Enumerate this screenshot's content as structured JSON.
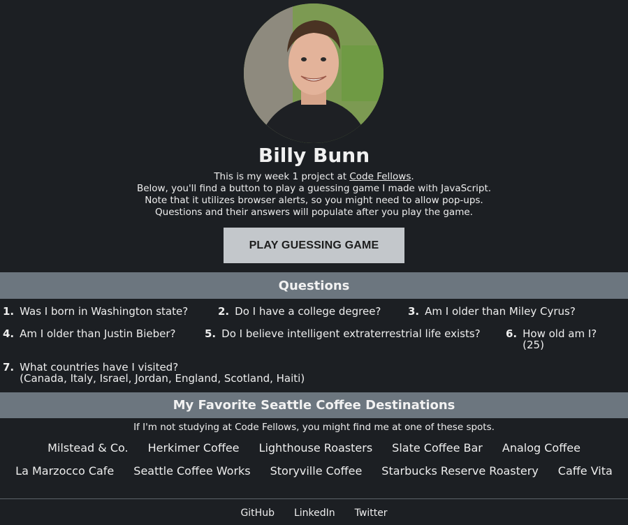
{
  "profile": {
    "name": "Billy Bunn",
    "intro": {
      "line1_prefix": "This is my week 1 project at ",
      "line1_link": "Code Fellows",
      "line1_suffix": ".",
      "line2": "Below, you'll find a button to play a guessing game I made with JavaScript.",
      "line3": "Note that it utilizes browser alerts, so you might need to allow pop-ups.",
      "line4": "Questions and their answers will populate after you play the game."
    },
    "play_button": "PLAY GUESSING GAME"
  },
  "questions": {
    "title": "Questions",
    "items": [
      {
        "num": "1.",
        "text": "Was I born in Washington state?",
        "answer": ""
      },
      {
        "num": "2.",
        "text": "Do I have a college degree?",
        "answer": ""
      },
      {
        "num": "3.",
        "text": "Am I older than Miley Cyrus?",
        "answer": ""
      },
      {
        "num": "4.",
        "text": "Am I older than Justin Bieber?",
        "answer": ""
      },
      {
        "num": "5.",
        "text": "Do I believe intelligent extraterrestrial life exists?",
        "answer": ""
      },
      {
        "num": "6.",
        "text": "How old am I?",
        "answer": "(25)"
      },
      {
        "num": "7.",
        "text": "What countries have I visited?",
        "answer": "(Canada, Italy, Israel, Jordan, England, Scotland, Haiti)"
      }
    ]
  },
  "coffee": {
    "title": "My Favorite Seattle Coffee Destinations",
    "intro": "If I'm not studying at Code Fellows, you might find me at one of these spots.",
    "row1": [
      "Milstead & Co.",
      "Herkimer Coffee",
      "Lighthouse Roasters",
      "Slate Coffee Bar",
      "Analog Coffee"
    ],
    "row2": [
      "La Marzocco Cafe",
      "Seattle Coffee Works",
      "Storyville Coffee",
      "Starbucks Reserve Roastery",
      "Caffe Vita"
    ]
  },
  "footer": {
    "links": [
      "GitHub",
      "LinkedIn",
      "Twitter"
    ]
  },
  "colors": {
    "background": "#1c1f23",
    "section_bar": "#6c767f",
    "button": "#c3c7cb"
  }
}
